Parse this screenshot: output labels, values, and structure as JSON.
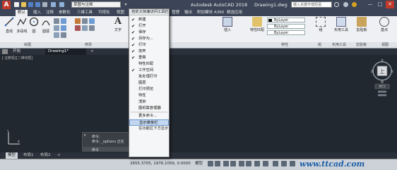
{
  "titlebar": {
    "workspace": "草图与注释",
    "app_title": "Autodesk AutoCAD 2018",
    "doc_title": "Drawing1.dwg",
    "search_placeholder": "键入关键字或短语",
    "window_buttons": [
      "—",
      "□",
      "✕"
    ]
  },
  "ribbon": {
    "tabs": [
      "默认",
      "插入",
      "注释",
      "参数化",
      "三维工具",
      "可视化",
      "视图",
      "管理",
      "输出",
      "附加模块",
      "A360",
      "精选应用"
    ],
    "active_tab": "默认",
    "draw_buttons": [
      "直线",
      "多段线",
      "圆",
      "圆弧"
    ],
    "annotation_button": "文字",
    "right_buttons": [
      "插入",
      "特性匹配",
      "组",
      "实用工具",
      "剪贴板",
      "基点"
    ],
    "properties_combos": [
      "ByLayer",
      "ByLayer",
      "ByLayer"
    ],
    "panel_labels": [
      "绘图",
      "修改",
      "特性",
      "组",
      "实用工具",
      "剪贴板",
      "视图"
    ]
  },
  "menu": {
    "header": "自定义快速访问工具栏",
    "items": [
      {
        "label": "新建",
        "checked": true
      },
      {
        "label": "打开",
        "checked": true
      },
      {
        "label": "保存",
        "checked": true
      },
      {
        "label": "另存为...",
        "checked": true
      },
      {
        "label": "打印",
        "checked": true
      },
      {
        "label": "放弃",
        "checked": true
      },
      {
        "label": "重做",
        "checked": true
      },
      {
        "label": "特性匹配",
        "checked": false
      },
      {
        "label": "工作空间",
        "checked": true
      },
      {
        "label": "批处理打印",
        "checked": false
      },
      {
        "label": "图层",
        "checked": false
      },
      {
        "label": "打印预览",
        "checked": false
      },
      {
        "label": "特性",
        "checked": false
      },
      {
        "label": "渲染",
        "checked": false
      },
      {
        "label": "图纸集管理器",
        "checked": false
      },
      {
        "label": "更多命令...",
        "checked": false
      },
      {
        "label": "显示菜单栏",
        "checked": false,
        "highlighted": true
      },
      {
        "label": "在功能区下方显示",
        "checked": false
      }
    ]
  },
  "file_tabs": [
    "开始",
    "Drawing1*",
    "+"
  ],
  "command": {
    "line1": "命令:",
    "line2": "命令: _options  正在",
    "prompt": "命令"
  },
  "viewcube": {
    "top": "上",
    "compass_letters": [
      "北",
      "西",
      "东",
      "南"
    ],
    "wcs": "WCS"
  },
  "layout_tabs": [
    "模型",
    "布局1",
    "布局2",
    "+"
  ],
  "status": {
    "coords": "2655.3705, 1976.1056, 0.0000",
    "model_label": "模型"
  },
  "watermark": "www.ttcad.com",
  "colors": {
    "titlebar": "#3b4557",
    "ribbon": "#eef0f3",
    "canvas": "#212830",
    "menu_highlight": "#c3d7f0",
    "watermark": "#1d5fa8"
  }
}
